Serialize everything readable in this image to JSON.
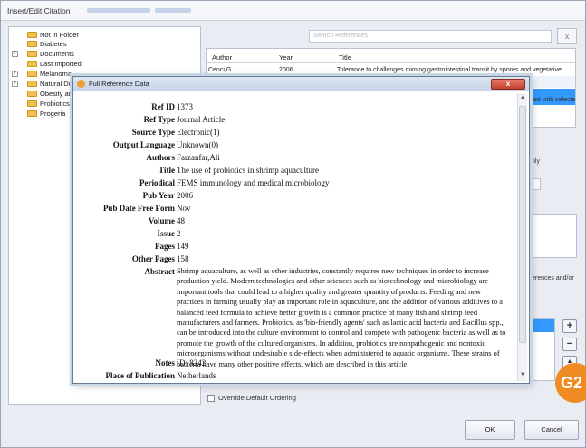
{
  "window": {
    "title": "Insert/Edit Citation"
  },
  "tree": {
    "items": [
      {
        "label": "Not in Folder",
        "expandable": false
      },
      {
        "label": "Diabetes",
        "expandable": false
      },
      {
        "label": "Documents",
        "expandable": true
      },
      {
        "label": "Last Imported",
        "expandable": false
      },
      {
        "label": "Melanoma",
        "expandable": true
      },
      {
        "label": "Natural Di",
        "expandable": true
      },
      {
        "label": "Obesity and",
        "expandable": false
      },
      {
        "label": "Probiotics",
        "expandable": false
      },
      {
        "label": "Progeria",
        "expandable": false
      }
    ]
  },
  "search": {
    "placeholder": "Search References",
    "clear": "x"
  },
  "grid": {
    "headers": [
      "Author",
      "Year",
      "Title"
    ],
    "rows": [
      {
        "author": "Cenci,G.",
        "year": "2006",
        "title": "Tolerance to challenges miming gastrointestinal transit by spores and vegetative"
      }
    ]
  },
  "right_pane": {
    "fragment_only": "nly",
    "fragment_selected": "ed with selecte",
    "fragment_refs": "erences and/or",
    "add": "+",
    "remove": "−",
    "up": "▲"
  },
  "override": {
    "label": "Override Default Ordering"
  },
  "buttons": {
    "ok": "OK",
    "cancel": "Cancel"
  },
  "badge": {
    "text": "G2"
  },
  "modal": {
    "title": "Full Reference Data",
    "close": "x",
    "fields": [
      {
        "label": "Ref ID",
        "value": "1373"
      },
      {
        "label": "Ref Type",
        "value": "Journal Article"
      },
      {
        "label": "Source Type",
        "value": "Electronic(1)"
      },
      {
        "label": "Output Language",
        "value": "Unknown(0)"
      },
      {
        "label": "Authors",
        "value": "Farzanfar,Ali"
      },
      {
        "label": "Title",
        "value": "The use of probiotics in shrimp aquaculture"
      },
      {
        "label": "Periodical",
        "value": "FEMS immunology and medical microbiology"
      },
      {
        "label": "Pub Year",
        "value": "2006"
      },
      {
        "label": "Pub Date Free Form",
        "value": "Nov"
      },
      {
        "label": "Volume",
        "value": "48"
      },
      {
        "label": "Issue",
        "value": "2"
      },
      {
        "label": "Pages",
        "value": "149"
      },
      {
        "label": "Other Pages",
        "value": "158"
      }
    ],
    "abstract_label": "Abstract",
    "abstract": "Shrimp aquaculture, as well as other industries, constantly requires new techniques in order to increase production yield. Modern technologies and other sciences such as biotechnology and microbiology are important tools that could lead to a higher quality and greater quantity of products. Feeding and new practices in farming usually play an important role in aquaculture, and the addition of various additives to a balanced feed formula to achieve better growth is a common practice of many fish and shrimp feed manufacturers and farmers. Probiotics, as 'bio-friendly agents' such as lactic acid bacteria and Bacillus spp., can be introduced into the culture environment to control and compete with pathogenic bacteria as well as to promote the growth of the cultured organisms. In addition, probiotics are nonpathogenic and nontoxic microorganisms without undesirable side-effects when administered to aquatic organisms. These strains of bacteria have many other positive effects, which are described in this article.",
    "notes_label": "Notes",
    "notes": "ID: 8242",
    "place_label": "Place of Publication",
    "place": "Netherlands"
  }
}
